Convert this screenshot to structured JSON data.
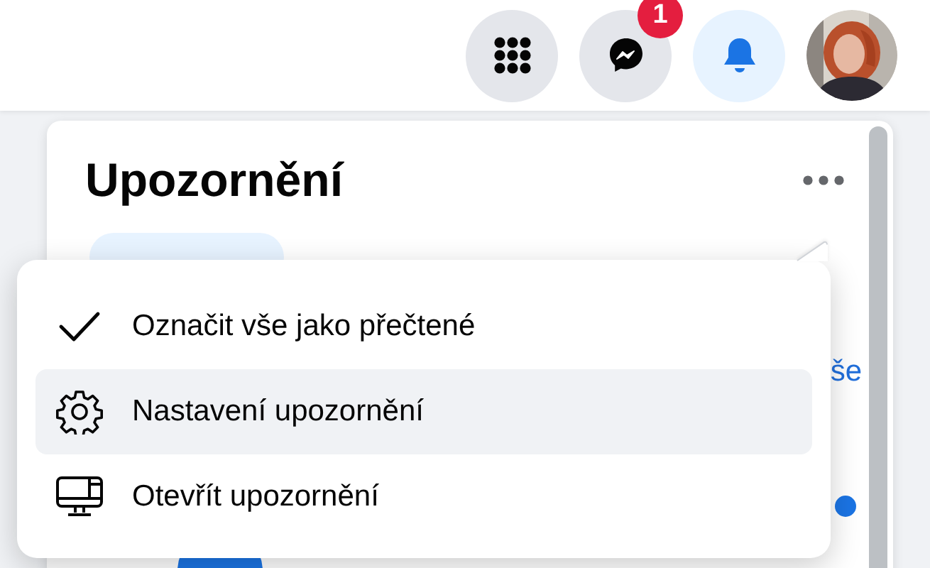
{
  "top_bar": {
    "buttons": [
      {
        "kind": "menu",
        "selected": false
      },
      {
        "kind": "messenger",
        "selected": false,
        "badge": "1"
      },
      {
        "kind": "notifications",
        "selected": true
      }
    ]
  },
  "panel": {
    "title": "Upozornění",
    "link_fragment": "še"
  },
  "menu": {
    "items": [
      {
        "kind": "check",
        "label": "Označit vše jako přečtené",
        "highlighted": false
      },
      {
        "kind": "settings",
        "label": "Nastavení upozornění",
        "highlighted": true
      },
      {
        "kind": "monitor",
        "label": "Otevřít upozornění",
        "highlighted": false
      }
    ]
  }
}
